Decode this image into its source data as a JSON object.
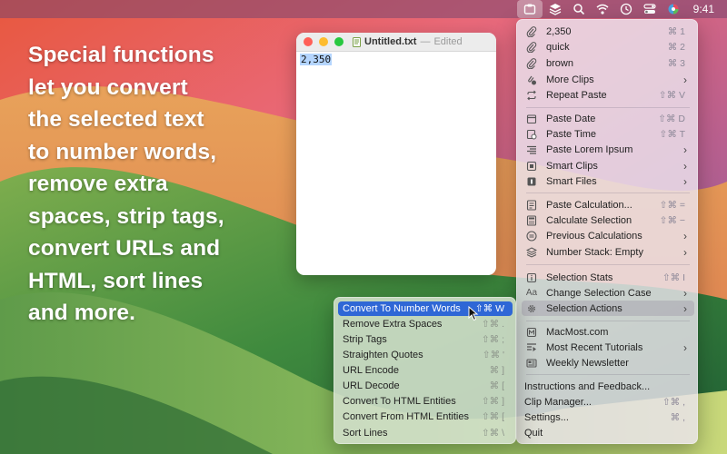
{
  "menubar": {
    "clock": "9:41",
    "icons": [
      "clipboard-app-icon",
      "layers-icon",
      "search-icon",
      "wifi-icon",
      "clock-icon",
      "control-center-icon",
      "color-wheel-icon"
    ]
  },
  "promo": {
    "text": "Special functions\nlet you convert\nthe selected text\nto number words,\nremove extra\nspaces, strip tags,\nconvert URLs and\nHTML, sort lines\nand more."
  },
  "editor": {
    "filename": "Untitled.txt",
    "separator": "—",
    "status": "Edited",
    "content": "2,350"
  },
  "menu": {
    "clips": [
      {
        "label": "2,350",
        "shortcut": "⌘ 1",
        "icon": "paperclip-icon"
      },
      {
        "label": "quick",
        "shortcut": "⌘ 2",
        "icon": "paperclip-icon"
      },
      {
        "label": "brown",
        "shortcut": "⌘ 3",
        "icon": "paperclip-icon"
      },
      {
        "label": "More Clips",
        "icon": "clips-stack-icon"
      },
      {
        "label": "Repeat Paste",
        "shortcut": "⇧⌘ V",
        "icon": "repeat-icon"
      }
    ],
    "pastes": [
      {
        "label": "Paste Date",
        "shortcut": "⇧⌘ D",
        "icon": "calendar-icon"
      },
      {
        "label": "Paste Time",
        "shortcut": "⇧⌘ T",
        "icon": "clock-doc-icon"
      },
      {
        "label": "Paste Lorem Ipsum",
        "icon": "text-lines-icon"
      },
      {
        "label": "Smart Clips",
        "icon": "smart-clip-icon"
      },
      {
        "label": "Smart Files",
        "icon": "smart-file-icon"
      }
    ],
    "calcs": [
      {
        "label": "Paste Calculation...",
        "shortcut": "⇧⌘ =",
        "icon": "calc-doc-icon"
      },
      {
        "label": "Calculate Selection",
        "shortcut": "⇧⌘ −",
        "icon": "calculator-icon"
      },
      {
        "label": "Previous Calculations",
        "icon": "equals-circle-icon"
      },
      {
        "label": "Number Stack: Empty",
        "icon": "stack-icon"
      }
    ],
    "selection": [
      {
        "label": "Selection Stats",
        "shortcut": "⇧⌘ I",
        "icon": "info-icon"
      },
      {
        "label": "Change Selection Case",
        "icon": "case-icon",
        "glyph": "Aa"
      },
      {
        "label": "Selection Actions",
        "icon": "gear-icon"
      }
    ],
    "links": [
      {
        "label": "MacMost.com",
        "icon": "m-logo-icon"
      },
      {
        "label": "Most Recent Tutorials",
        "icon": "play-list-icon"
      },
      {
        "label": "Weekly Newsletter",
        "icon": "newsletter-icon"
      }
    ],
    "footer": [
      {
        "label": "Instructions and Feedback..."
      },
      {
        "label": "Clip Manager...",
        "shortcut": "⇧⌘ ,"
      },
      {
        "label": "Settings...",
        "shortcut": "⌘ ,"
      },
      {
        "label": "Quit"
      }
    ]
  },
  "submenu": {
    "items": [
      {
        "label": "Convert To Number Words",
        "shortcut": "⇧⌘ W"
      },
      {
        "label": "Remove Extra Spaces",
        "shortcut": "⇧⌘ ."
      },
      {
        "label": "Strip Tags",
        "shortcut": "⇧⌘ ;"
      },
      {
        "label": "Straighten Quotes",
        "shortcut": "⇧⌘ '"
      },
      {
        "label": "URL Encode",
        "shortcut": "⌘ ]"
      },
      {
        "label": "URL Decode",
        "shortcut": "⌘ ["
      },
      {
        "label": "Convert To HTML Entities",
        "shortcut": "⇧⌘ ]"
      },
      {
        "label": "Convert From HTML Entities",
        "shortcut": "⇧⌘ ["
      },
      {
        "label": "Sort Lines",
        "shortcut": "⇧⌘ \\"
      }
    ]
  },
  "colors": {
    "highlight": "#2f67d6",
    "selection": "#b4d5fe"
  }
}
